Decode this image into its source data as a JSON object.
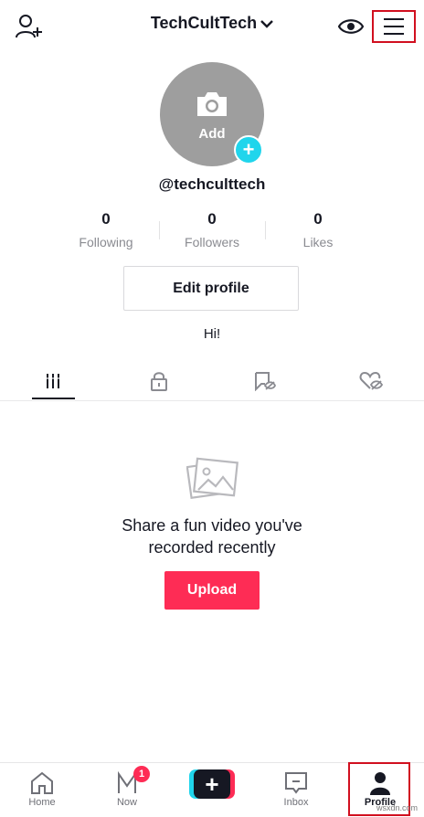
{
  "header": {
    "username_title": "TechCultTech",
    "icons": {
      "add_user": "person-plus-icon",
      "dropdown": "chevron-down-icon",
      "views": "eye-icon",
      "menu": "hamburger-menu-icon"
    }
  },
  "profile": {
    "avatar_label": "Add",
    "handle": "@techculttech",
    "bio": "Hi!",
    "edit_button": "Edit profile"
  },
  "stats": [
    {
      "value": "0",
      "label": "Following"
    },
    {
      "value": "0",
      "label": "Followers"
    },
    {
      "value": "0",
      "label": "Likes"
    }
  ],
  "tabs": [
    {
      "icon": "grid-videos-icon",
      "active": true
    },
    {
      "icon": "lock-private-icon",
      "active": false
    },
    {
      "icon": "tag-hidden-icon",
      "active": false
    },
    {
      "icon": "liked-hidden-icon",
      "active": false
    }
  ],
  "empty_state": {
    "line1": "Share a fun video you've",
    "line2": "recorded recently",
    "upload_button": "Upload"
  },
  "bottom_nav": {
    "items": [
      {
        "label": "Home",
        "icon": "home-icon"
      },
      {
        "label": "Now",
        "icon": "now-icon",
        "badge": "1"
      },
      {
        "label": "",
        "icon": "create-plus-icon"
      },
      {
        "label": "Inbox",
        "icon": "inbox-icon"
      },
      {
        "label": "Profile",
        "icon": "profile-icon",
        "active": true
      }
    ]
  },
  "watermark": "wsxdn.com",
  "colors": {
    "accent_red": "#fe2c55",
    "accent_cyan": "#20d5ec",
    "highlight_box": "#d10f1f"
  }
}
